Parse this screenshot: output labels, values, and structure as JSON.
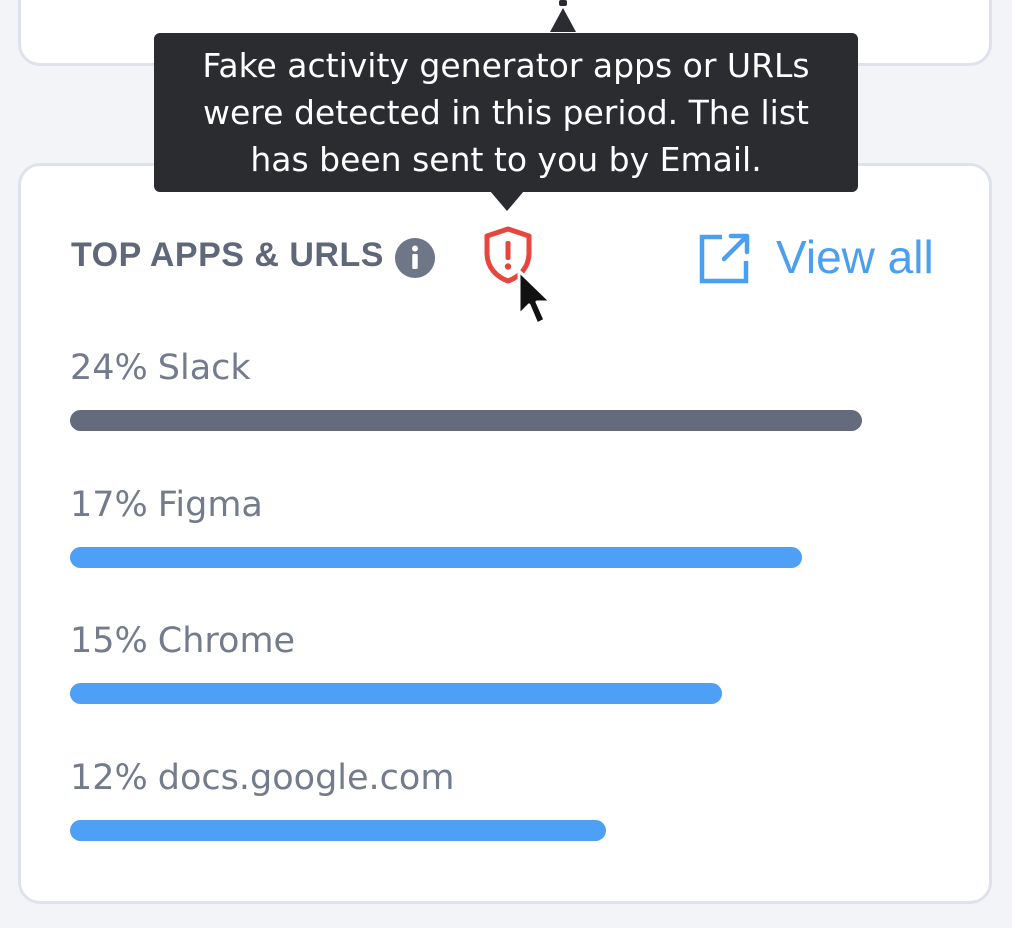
{
  "tooltip": {
    "lines": [
      "Fake activity generator apps or URLs",
      "were detected in this period. The list",
      "has been sent to you by Email."
    ]
  },
  "section": {
    "title": "TOP APPS & URLS",
    "info_icon": "info-icon",
    "alert_icon": "shield-alert-icon",
    "view_all_label": "View all",
    "view_all_icon": "external-link-icon"
  },
  "apps": [
    {
      "percent_label": "24%",
      "name": "Slack",
      "bar_fraction": 0.99,
      "active": true
    },
    {
      "percent_label": "17%",
      "name": "Figma",
      "bar_fraction": 0.915,
      "active": false
    },
    {
      "percent_label": "15%",
      "name": "Chrome",
      "bar_fraction": 0.815,
      "active": false
    },
    {
      "percent_label": "12%",
      "name": "docs.google.com",
      "bar_fraction": 0.67,
      "active": false
    }
  ],
  "colors": {
    "bar_active": "#636b7c",
    "bar_default": "#4da0f5",
    "alert": "#e8453c",
    "link": "#4b9ff0",
    "tooltip_bg": "#2b2c2f"
  }
}
